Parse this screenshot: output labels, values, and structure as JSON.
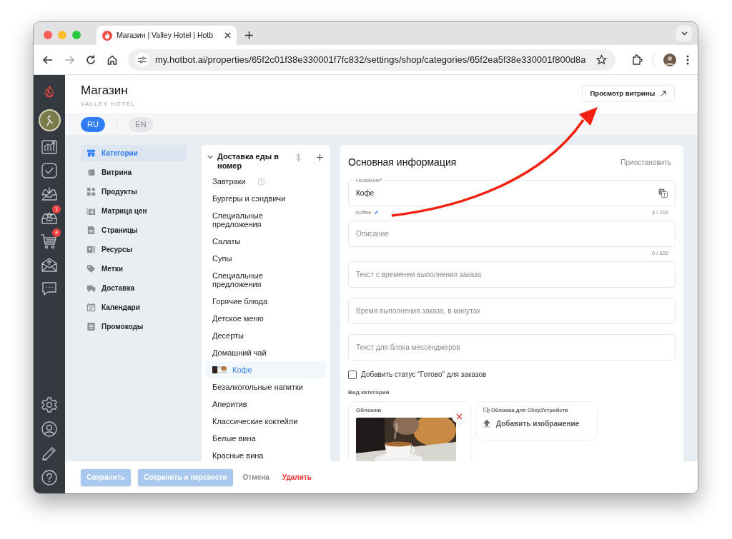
{
  "browser": {
    "tab_title": "Магазин | Valley Hotel | Hotb",
    "url": "my.hotbot.ai/properties/65f2c01f38e330001f7fc832/settings/shop/categories/65f2ea5f38e330001f800d8a"
  },
  "rail": {
    "items": [
      {
        "kind": "chart"
      },
      {
        "kind": "tasks"
      },
      {
        "kind": "inbox"
      },
      {
        "kind": "reviews",
        "badge": "1"
      },
      {
        "kind": "cart",
        "badge": "4"
      },
      {
        "kind": "mail"
      },
      {
        "kind": "chat"
      }
    ],
    "bottom": [
      {
        "kind": "settings"
      },
      {
        "kind": "profile"
      },
      {
        "kind": "edit"
      },
      {
        "kind": "help"
      }
    ]
  },
  "header": {
    "title": "Магазин",
    "subtitle": "VALLEY HOTEL",
    "preview_button": "Просмотр витрины"
  },
  "languages": [
    {
      "label": "RU",
      "selected": true
    },
    {
      "label": "EN",
      "selected": false
    }
  ],
  "nav": [
    {
      "label": "Категории",
      "kind": "store",
      "selected": true
    },
    {
      "label": "Витрина",
      "kind": "cards",
      "selected": false
    },
    {
      "label": "Продукты",
      "kind": "grid",
      "selected": false
    },
    {
      "label": "Матрица цен",
      "kind": "matrix",
      "selected": false
    },
    {
      "label": "Страницы",
      "kind": "page",
      "selected": false
    },
    {
      "label": "Ресурсы",
      "kind": "resource",
      "selected": false
    },
    {
      "label": "Метки",
      "kind": "tag",
      "selected": false
    },
    {
      "label": "Доставка",
      "kind": "truck",
      "selected": false
    },
    {
      "label": "Календари",
      "kind": "calendar",
      "selected": false
    },
    {
      "label": "Промокоды",
      "kind": "list",
      "selected": false
    }
  ],
  "categories": {
    "title": "Доставка еды в номер",
    "expanded": true,
    "children": [
      {
        "label": "Завтраки",
        "scheduled": true,
        "selected": false
      },
      {
        "label": "Бургеры и сэндвичи",
        "selected": false
      },
      {
        "label": "Специальные предложения",
        "selected": false
      },
      {
        "label": "Салаты",
        "selected": false
      },
      {
        "label": "Супы",
        "selected": false
      },
      {
        "label": "Специальные предложения",
        "selected": false
      },
      {
        "label": "Горячие блюда",
        "selected": false
      },
      {
        "label": "Детское меню",
        "selected": false
      },
      {
        "label": "Десерты",
        "selected": false
      },
      {
        "label": "Домашний чай",
        "selected": false
      },
      {
        "label": "Кофе",
        "thumbnail": true,
        "selected": true
      },
      {
        "label": "Безалкогольные напитки",
        "selected": false
      },
      {
        "label": "Аперитив",
        "selected": false
      },
      {
        "label": "Классические коктейли",
        "selected": false
      },
      {
        "label": "Белые вина",
        "selected": false
      },
      {
        "label": "Красные вина",
        "selected": false
      }
    ]
  },
  "form": {
    "title": "Основная информация",
    "pause_button": "Приостановить",
    "fields": [
      {
        "kind": "labeled",
        "label": "Название*",
        "value": "Кофе",
        "slug": "/coffee",
        "counter": "4 / 200"
      },
      {
        "kind": "plain",
        "placeholder": "Описание",
        "counter": "0 / 600"
      },
      {
        "kind": "plain",
        "placeholder": "Текст с временем выполнения заказа"
      },
      {
        "kind": "plain",
        "placeholder": "Время выполнения заказа, в минутах"
      },
      {
        "kind": "plain",
        "placeholder": "Текст для блока мессенджеров"
      }
    ],
    "ready_status": {
      "label": "Добавить статус \"Готово\" для заказов",
      "checked": false
    },
    "view_label": "Вид категории",
    "cover": {
      "label": "Обложка"
    },
    "sber_cover": {
      "label": "Обложка для СберУстройств",
      "button": "Добавить изображение"
    }
  },
  "footer": [
    {
      "label": "Сохранить",
      "kind": "primary",
      "disabled": true
    },
    {
      "label": "Сохранить и перевести",
      "kind": "primary",
      "disabled": true
    },
    {
      "label": "Отмена",
      "kind": "text",
      "disabled": false
    },
    {
      "label": "Удалить",
      "kind": "danger",
      "disabled": false
    }
  ]
}
